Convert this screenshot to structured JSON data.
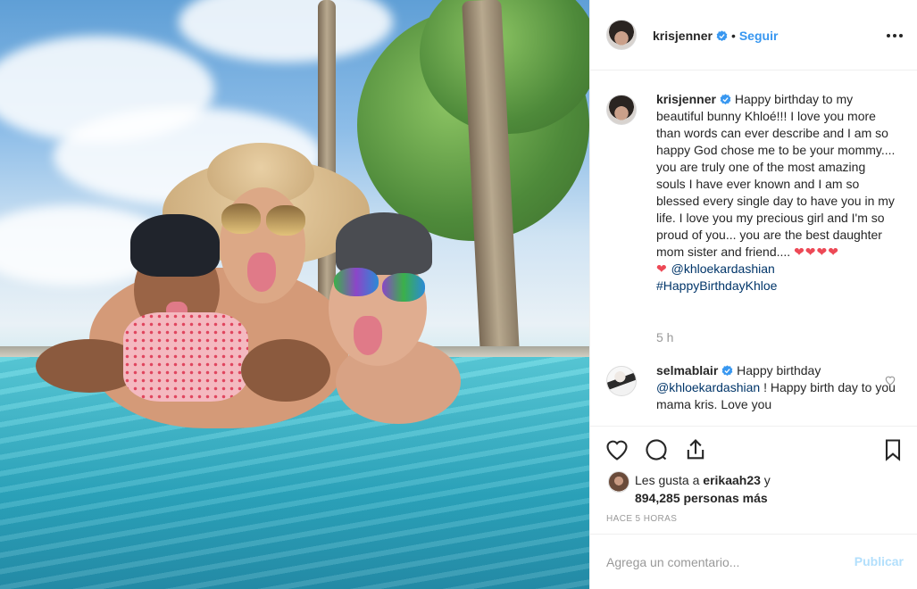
{
  "post": {
    "author": "krisjenner",
    "follow_label": "Seguir",
    "separator": "•"
  },
  "caption": {
    "author": "krisjenner",
    "text": "Happy birthday to my beautiful bunny Khloé!!! I love you more than words can ever describe and I am so happy God chose me to be your mommy.... you are truly one of the most amazing souls I have ever known and I am so blessed every single day to have you in my life. I love you my precious girl and I'm so proud of you... you are the best daughter mom sister and friend....",
    "hearts": "❤❤❤❤",
    "heart_single": "❤",
    "mention": "@khloekardashian",
    "hashtag": "#HappyBirthdayKhloe",
    "time": "5 h"
  },
  "comments": [
    {
      "author": "selmablair",
      "text_before": "Happy birthday",
      "mention": "@khloekardashian",
      "text_after": "! Happy birth day to you mama kris. Love you"
    }
  ],
  "likes": {
    "prefix": "Les gusta a",
    "user": "erikaah23",
    "conj": "y",
    "count": "894,285 personas más"
  },
  "posted_ago": "HACE 5 HORAS",
  "comment_box": {
    "placeholder": "Agrega un comentario...",
    "publish_label": "Publicar"
  },
  "icons": [
    "verified-badge-icon",
    "more-options-icon",
    "heart-icon",
    "comment-icon",
    "share-icon",
    "bookmark-icon",
    "comment-like-icon"
  ],
  "colors": {
    "link": "#3897f0",
    "mention": "#003569",
    "heart": "#ed4956",
    "muted": "#999999",
    "publish_disabled": "#b2dffc"
  }
}
